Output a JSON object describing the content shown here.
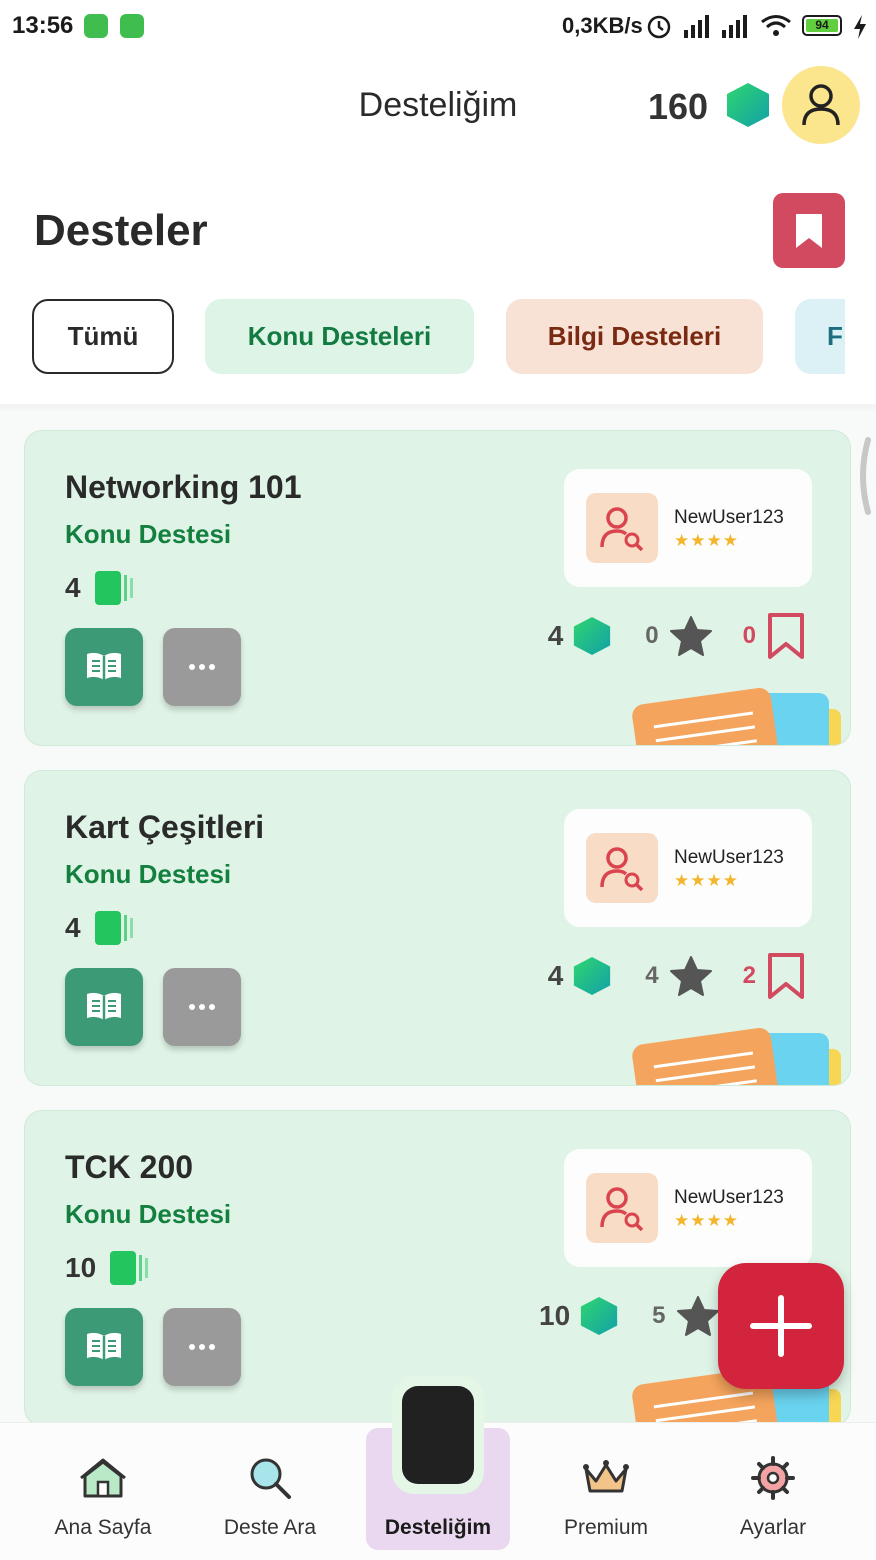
{
  "status_bar": {
    "time": "13:56",
    "network_speed": "0,3KB/s",
    "battery": "94"
  },
  "header": {
    "title": "Desteliğim",
    "gems": "160"
  },
  "section": {
    "title": "Desteler"
  },
  "filters": [
    {
      "label": "Tümü"
    },
    {
      "label": "Konu Desteleri"
    },
    {
      "label": "Bilgi Desteleri"
    },
    {
      "label": "F"
    }
  ],
  "decks": [
    {
      "title": "Networking 101",
      "type": "Konu Destesi",
      "card_count": "4",
      "owner": "NewUser123",
      "stars": "★★★★",
      "gems": "4",
      "rating": "0",
      "saves": "0"
    },
    {
      "title": "Kart Çeşitleri",
      "type": "Konu Destesi",
      "card_count": "4",
      "owner": "NewUser123",
      "stars": "★★★★",
      "gems": "4",
      "rating": "4",
      "saves": "2"
    },
    {
      "title": "TCK 200",
      "type": "Konu Destesi",
      "card_count": "10",
      "owner": "NewUser123",
      "stars": "★★★★",
      "gems": "10",
      "rating": "5",
      "saves": ""
    }
  ],
  "nav": [
    {
      "label": "Ana Sayfa",
      "icon": "home-icon"
    },
    {
      "label": "Deste Ara",
      "icon": "search-icon"
    },
    {
      "label": "Desteliğim",
      "icon": "deck-icon",
      "active": true
    },
    {
      "label": "Premium",
      "icon": "crown-icon"
    },
    {
      "label": "Ayarlar",
      "icon": "gear-icon"
    }
  ],
  "colors": {
    "accent_red": "#d3243d",
    "card_bg": "#dff4e6",
    "primary_green": "#3d9a77",
    "type_green": "#13803f",
    "bookmark_red": "#d24a60"
  }
}
